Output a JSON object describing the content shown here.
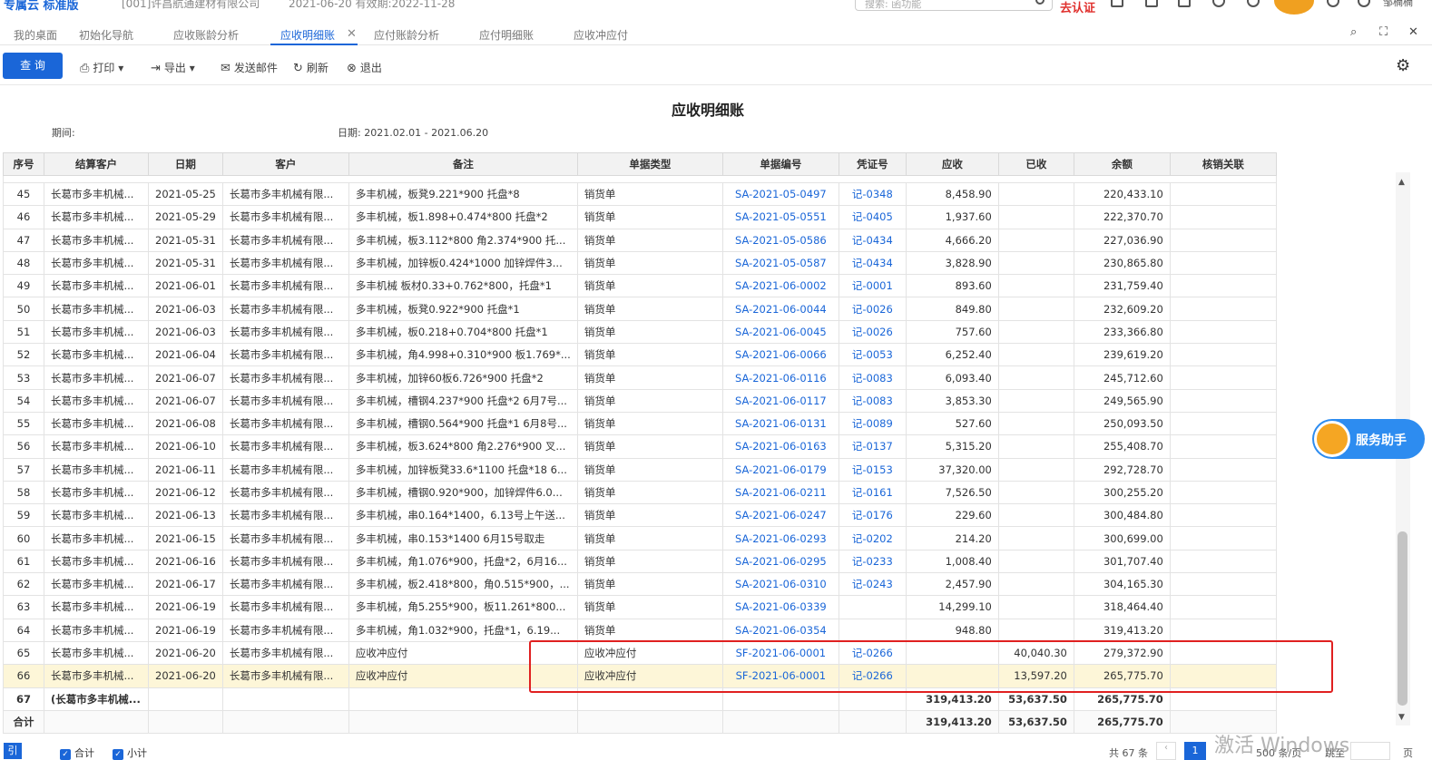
{
  "app": {
    "brand": "专属云 标准版",
    "company": "[001]许昌航通建材有限公司",
    "dates": "2021-06-20   有效期:2022-11-28",
    "search_placeholder": "搜索: 函功能",
    "cert": "去认证",
    "user": "邹楠楠"
  },
  "tabs": [
    "我的桌面",
    "初始化导航",
    "应收账龄分析",
    "应收明细账",
    "应付账龄分析",
    "应付明细账",
    "应收冲应付"
  ],
  "active_tab_index": 3,
  "toolbar": {
    "query": "查 询",
    "print": "打印",
    "export": "导出",
    "email": "发送邮件",
    "refresh": "刷新",
    "exit": "退出"
  },
  "report": {
    "title": "应收明细账",
    "period_label": "期间:",
    "date_range": "日期:  2021.02.01 - 2021.06.20"
  },
  "columns": [
    "序号",
    "结算客户",
    "日期",
    "客户",
    "备注",
    "单据类型",
    "单据编号",
    "凭证号",
    "应收",
    "已收",
    "余额",
    "核销关联"
  ],
  "rows": [
    {
      "no": "45",
      "settle": "长葛市多丰机械...",
      "date": "2021-05-25",
      "cust": "长葛市多丰机械有限...",
      "note": "多丰机械，板凳9.221*900 托盘*8",
      "type": "销货单",
      "doc": "SA-2021-05-0497",
      "voucher": "记-0348",
      "recv": "8,458.90",
      "paid": "",
      "bal": "220,433.10"
    },
    {
      "no": "46",
      "settle": "长葛市多丰机械...",
      "date": "2021-05-29",
      "cust": "长葛市多丰机械有限...",
      "note": "多丰机械，板1.898+0.474*800 托盘*2",
      "type": "销货单",
      "doc": "SA-2021-05-0551",
      "voucher": "记-0405",
      "recv": "1,937.60",
      "paid": "",
      "bal": "222,370.70"
    },
    {
      "no": "47",
      "settle": "长葛市多丰机械...",
      "date": "2021-05-31",
      "cust": "长葛市多丰机械有限...",
      "note": "多丰机械，板3.112*800 角2.374*900 托...",
      "type": "销货单",
      "doc": "SA-2021-05-0586",
      "voucher": "记-0434",
      "recv": "4,666.20",
      "paid": "",
      "bal": "227,036.90"
    },
    {
      "no": "48",
      "settle": "长葛市多丰机械...",
      "date": "2021-05-31",
      "cust": "长葛市多丰机械有限...",
      "note": "多丰机械，加锌板0.424*1000 加锌焊件3...",
      "type": "销货单",
      "doc": "SA-2021-05-0587",
      "voucher": "记-0434",
      "recv": "3,828.90",
      "paid": "",
      "bal": "230,865.80"
    },
    {
      "no": "49",
      "settle": "长葛市多丰机械...",
      "date": "2021-06-01",
      "cust": "长葛市多丰机械有限...",
      "note": "多丰机械 板材0.33+0.762*800，托盘*1",
      "type": "销货单",
      "doc": "SA-2021-06-0002",
      "voucher": "记-0001",
      "recv": "893.60",
      "paid": "",
      "bal": "231,759.40"
    },
    {
      "no": "50",
      "settle": "长葛市多丰机械...",
      "date": "2021-06-03",
      "cust": "长葛市多丰机械有限...",
      "note": "多丰机械，板凳0.922*900 托盘*1",
      "type": "销货单",
      "doc": "SA-2021-06-0044",
      "voucher": "记-0026",
      "recv": "849.80",
      "paid": "",
      "bal": "232,609.20"
    },
    {
      "no": "51",
      "settle": "长葛市多丰机械...",
      "date": "2021-06-03",
      "cust": "长葛市多丰机械有限...",
      "note": "多丰机械，板0.218+0.704*800 托盘*1",
      "type": "销货单",
      "doc": "SA-2021-06-0045",
      "voucher": "记-0026",
      "recv": "757.60",
      "paid": "",
      "bal": "233,366.80"
    },
    {
      "no": "52",
      "settle": "长葛市多丰机械...",
      "date": "2021-06-04",
      "cust": "长葛市多丰机械有限...",
      "note": "多丰机械，角4.998+0.310*900 板1.769*...",
      "type": "销货单",
      "doc": "SA-2021-06-0066",
      "voucher": "记-0053",
      "recv": "6,252.40",
      "paid": "",
      "bal": "239,619.20"
    },
    {
      "no": "53",
      "settle": "长葛市多丰机械...",
      "date": "2021-06-07",
      "cust": "长葛市多丰机械有限...",
      "note": "多丰机械，加锌60板6.726*900 托盘*2",
      "type": "销货单",
      "doc": "SA-2021-06-0116",
      "voucher": "记-0083",
      "recv": "6,093.40",
      "paid": "",
      "bal": "245,712.60"
    },
    {
      "no": "54",
      "settle": "长葛市多丰机械...",
      "date": "2021-06-07",
      "cust": "长葛市多丰机械有限...",
      "note": "多丰机械，槽钢4.237*900 托盘*2 6月7号...",
      "type": "销货单",
      "doc": "SA-2021-06-0117",
      "voucher": "记-0083",
      "recv": "3,853.30",
      "paid": "",
      "bal": "249,565.90"
    },
    {
      "no": "55",
      "settle": "长葛市多丰机械...",
      "date": "2021-06-08",
      "cust": "长葛市多丰机械有限...",
      "note": "多丰机械，槽钢0.564*900 托盘*1 6月8号...",
      "type": "销货单",
      "doc": "SA-2021-06-0131",
      "voucher": "记-0089",
      "recv": "527.60",
      "paid": "",
      "bal": "250,093.50"
    },
    {
      "no": "56",
      "settle": "长葛市多丰机械...",
      "date": "2021-06-10",
      "cust": "长葛市多丰机械有限...",
      "note": "多丰机械，板3.624*800 角2.276*900 叉...",
      "type": "销货单",
      "doc": "SA-2021-06-0163",
      "voucher": "记-0137",
      "recv": "5,315.20",
      "paid": "",
      "bal": "255,408.70"
    },
    {
      "no": "57",
      "settle": "长葛市多丰机械...",
      "date": "2021-06-11",
      "cust": "长葛市多丰机械有限...",
      "note": "多丰机械，加锌板凳33.6*1100 托盘*18 6...",
      "type": "销货单",
      "doc": "SA-2021-06-0179",
      "voucher": "记-0153",
      "recv": "37,320.00",
      "paid": "",
      "bal": "292,728.70"
    },
    {
      "no": "58",
      "settle": "长葛市多丰机械...",
      "date": "2021-06-12",
      "cust": "长葛市多丰机械有限...",
      "note": "多丰机械，槽钢0.920*900，加锌焊件6.0...",
      "type": "销货单",
      "doc": "SA-2021-06-0211",
      "voucher": "记-0161",
      "recv": "7,526.50",
      "paid": "",
      "bal": "300,255.20"
    },
    {
      "no": "59",
      "settle": "长葛市多丰机械...",
      "date": "2021-06-13",
      "cust": "长葛市多丰机械有限...",
      "note": "多丰机械，串0.164*1400，6.13号上午送...",
      "type": "销货单",
      "doc": "SA-2021-06-0247",
      "voucher": "记-0176",
      "recv": "229.60",
      "paid": "",
      "bal": "300,484.80"
    },
    {
      "no": "60",
      "settle": "长葛市多丰机械...",
      "date": "2021-06-15",
      "cust": "长葛市多丰机械有限...",
      "note": "多丰机械，串0.153*1400 6月15号取走",
      "type": "销货单",
      "doc": "SA-2021-06-0293",
      "voucher": "记-0202",
      "recv": "214.20",
      "paid": "",
      "bal": "300,699.00"
    },
    {
      "no": "61",
      "settle": "长葛市多丰机械...",
      "date": "2021-06-16",
      "cust": "长葛市多丰机械有限...",
      "note": "多丰机械，角1.076*900，托盘*2，6月16...",
      "type": "销货单",
      "doc": "SA-2021-06-0295",
      "voucher": "记-0233",
      "recv": "1,008.40",
      "paid": "",
      "bal": "301,707.40"
    },
    {
      "no": "62",
      "settle": "长葛市多丰机械...",
      "date": "2021-06-17",
      "cust": "长葛市多丰机械有限...",
      "note": "多丰机械，板2.418*800，角0.515*900，...",
      "type": "销货单",
      "doc": "SA-2021-06-0310",
      "voucher": "记-0243",
      "recv": "2,457.90",
      "paid": "",
      "bal": "304,165.30"
    },
    {
      "no": "63",
      "settle": "长葛市多丰机械...",
      "date": "2021-06-19",
      "cust": "长葛市多丰机械有限...",
      "note": "多丰机械，角5.255*900，板11.261*800...",
      "type": "销货单",
      "doc": "SA-2021-06-0339",
      "voucher": "",
      "recv": "14,299.10",
      "paid": "",
      "bal": "318,464.40"
    },
    {
      "no": "64",
      "settle": "长葛市多丰机械...",
      "date": "2021-06-19",
      "cust": "长葛市多丰机械有限...",
      "note": "多丰机械，角1.032*900，托盘*1，6.19...",
      "type": "销货单",
      "doc": "SA-2021-06-0354",
      "voucher": "",
      "recv": "948.80",
      "paid": "",
      "bal": "319,413.20"
    },
    {
      "no": "65",
      "settle": "长葛市多丰机械...",
      "date": "2021-06-20",
      "cust": "长葛市多丰机械有限...",
      "note": "应收冲应付",
      "type": "应收冲应付",
      "doc": "SF-2021-06-0001",
      "voucher": "记-0266",
      "recv": "",
      "paid": "40,040.30",
      "bal": "279,372.90"
    },
    {
      "no": "66",
      "settle": "长葛市多丰机械...",
      "date": "2021-06-20",
      "cust": "长葛市多丰机械有限...",
      "note": "应收冲应付",
      "type": "应收冲应付",
      "doc": "SF-2021-06-0001",
      "voucher": "记-0266",
      "recv": "",
      "paid": "13,597.20",
      "bal": "265,775.70",
      "highlight": true
    }
  ],
  "subtotal": {
    "no": "67",
    "settle": "(长葛市多丰机械...",
    "recv": "319,413.20",
    "paid": "53,637.50",
    "bal": "265,775.70"
  },
  "total": {
    "label": "合计",
    "recv": "319,413.20",
    "paid": "53,637.50",
    "bal": "265,775.70"
  },
  "assistant": "服务助手",
  "footer": {
    "icon": "引",
    "total_check": "合计",
    "subtotal_check": "小计",
    "total_count": "共 67 条",
    "page": "1",
    "page_size": "500 条/页",
    "jump": "跳至",
    "page_unit": "页",
    "watermark": "激活 Windows"
  }
}
